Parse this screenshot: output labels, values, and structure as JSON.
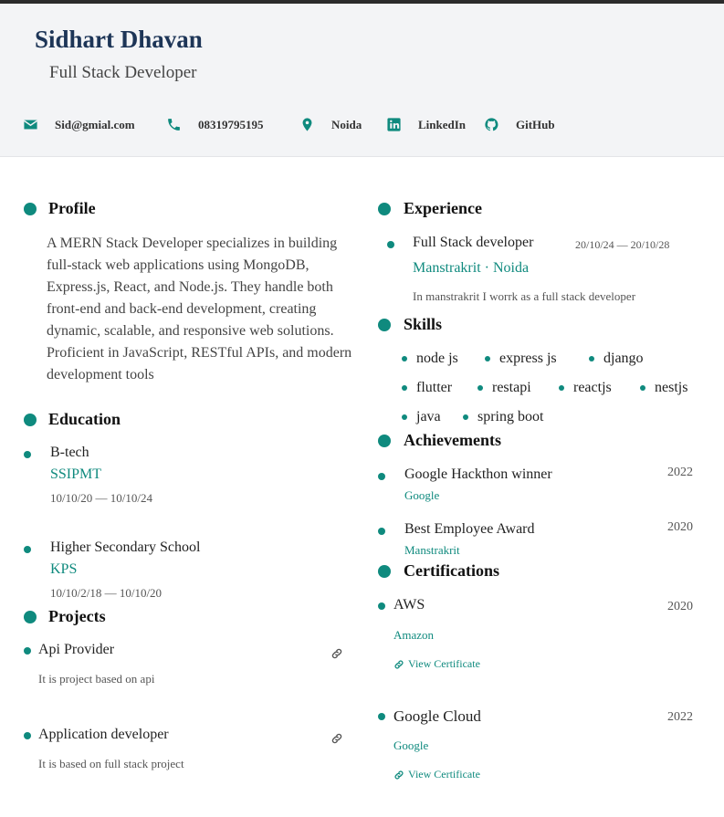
{
  "header": {
    "name": "Sidhart Dhavan",
    "title": "Full Stack Developer",
    "contacts": [
      {
        "icon": "mail-icon",
        "text": "Sid@gmial.com"
      },
      {
        "icon": "phone-icon",
        "text": "08319795195"
      },
      {
        "icon": "location-pin-icon",
        "text": "Noida"
      },
      {
        "icon": "linkedin-icon",
        "text": "LinkedIn"
      },
      {
        "icon": "github-icon",
        "text": "GitHub"
      }
    ]
  },
  "colors": {
    "accent": "#0f8a7e",
    "name": "#1d3557",
    "header_bg": "#f3f4f6"
  },
  "profile": {
    "heading": "Profile",
    "text": "A MERN Stack Developer specializes in building full-stack web applications using MongoDB, Express.js, React, and Node.js. They handle both front-end and back-end development, creating dynamic, scalable, and responsive web solutions. Proficient in JavaScript, RESTful APIs, and modern development tools"
  },
  "education": {
    "heading": "Education",
    "items": [
      {
        "degree": "B-tech",
        "school": "SSIPMT",
        "dates": "10/10/20 — 10/10/24"
      },
      {
        "degree": "Higher Secondary School",
        "school": "KPS",
        "dates": "10/10/2/18 — 10/10/20"
      }
    ]
  },
  "projects": {
    "heading": "Projects",
    "items": [
      {
        "name": "Api Provider",
        "desc": "It is project based on api"
      },
      {
        "name": "Application developer",
        "desc": "It is based on full stack project"
      }
    ]
  },
  "experience": {
    "heading": "Experience",
    "items": [
      {
        "role": "Full Stack developer",
        "dates": "20/10/24 — 20/10/28",
        "company": "Manstrakrit · Noida",
        "desc": "In manstrakrit I worrk as a full stack developer"
      }
    ]
  },
  "skills": {
    "heading": "Skills",
    "items": [
      "node js",
      "express js",
      "django",
      "flutter",
      "restapi",
      "reactjs",
      "nestjs",
      "java",
      "spring boot"
    ]
  },
  "achievements": {
    "heading": "Achievements",
    "items": [
      {
        "title": "Google Hackthon winner",
        "org": "Google",
        "year": "2022"
      },
      {
        "title": "Best Employee Award",
        "org": "Manstrakrit",
        "year": "2020"
      }
    ]
  },
  "certifications": {
    "heading": "Certifications",
    "link_label": "View Certificate",
    "items": [
      {
        "name": "AWS",
        "issuer": "Amazon",
        "year": "2020"
      },
      {
        "name": "Google Cloud",
        "issuer": "Google",
        "year": "2022"
      }
    ]
  }
}
